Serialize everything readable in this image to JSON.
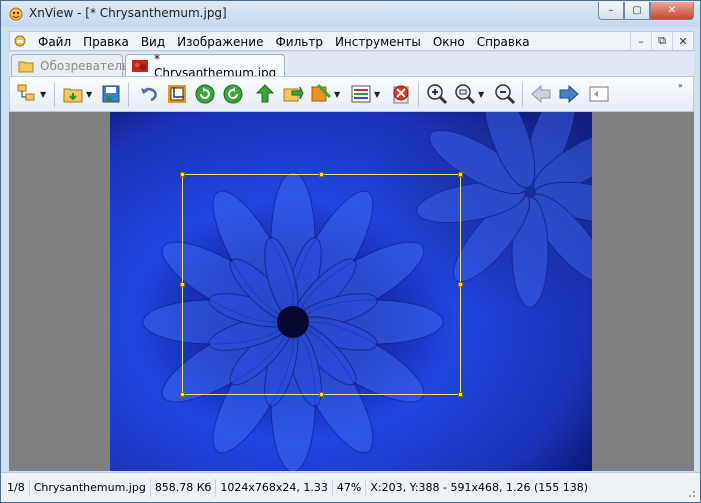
{
  "window": {
    "title": "XnView - [* Chrysanthemum.jpg]",
    "caption_minimize": "–",
    "caption_maximize": "▢",
    "caption_close": "✕"
  },
  "menu": {
    "items": [
      "Файл",
      "Правка",
      "Вид",
      "Изображение",
      "Фильтр",
      "Инструменты",
      "Окно",
      "Справка"
    ],
    "ctrl_minimize": "–",
    "ctrl_restore": "⧉",
    "ctrl_close": "✕"
  },
  "tabs": [
    {
      "label": "Обозреватель",
      "active": false,
      "icon": "folder-browser-icon"
    },
    {
      "label": "* Chrysanthemum.jpg",
      "active": true,
      "icon": "image-thumbnail-icon"
    }
  ],
  "toolbar": {
    "buttons": [
      "folder-tree-icon",
      "open-folder-icon",
      "save-icon",
      "undo-icon",
      "crop-icon",
      "rotate-left-icon",
      "rotate-right-icon",
      "move-up-icon",
      "export-icon",
      "adjust-icon",
      "palette-icon",
      "delete-icon",
      "zoom-in-icon",
      "zoom-fit-icon",
      "zoom-out-icon",
      "prev-arrow-icon",
      "next-arrow-icon",
      "fullscreen-icon"
    ],
    "accent_green": "#3aa63a",
    "accent_blue": "#4a7fc4",
    "accent_orange": "#e8941f"
  },
  "image": {
    "name": "chrysanthemum-photo",
    "dominant_color": "#1a3fd8",
    "selection_color": "#f0e070"
  },
  "status": {
    "index": "1/8",
    "filename": "Chrysanthemum.jpg",
    "filesize": "858.78 Кб",
    "dimensions": "1024x768x24, 1.33",
    "zoom": "47%",
    "selection": "X:203, Y:388 - 591x468, 1.26 (155 138)"
  }
}
